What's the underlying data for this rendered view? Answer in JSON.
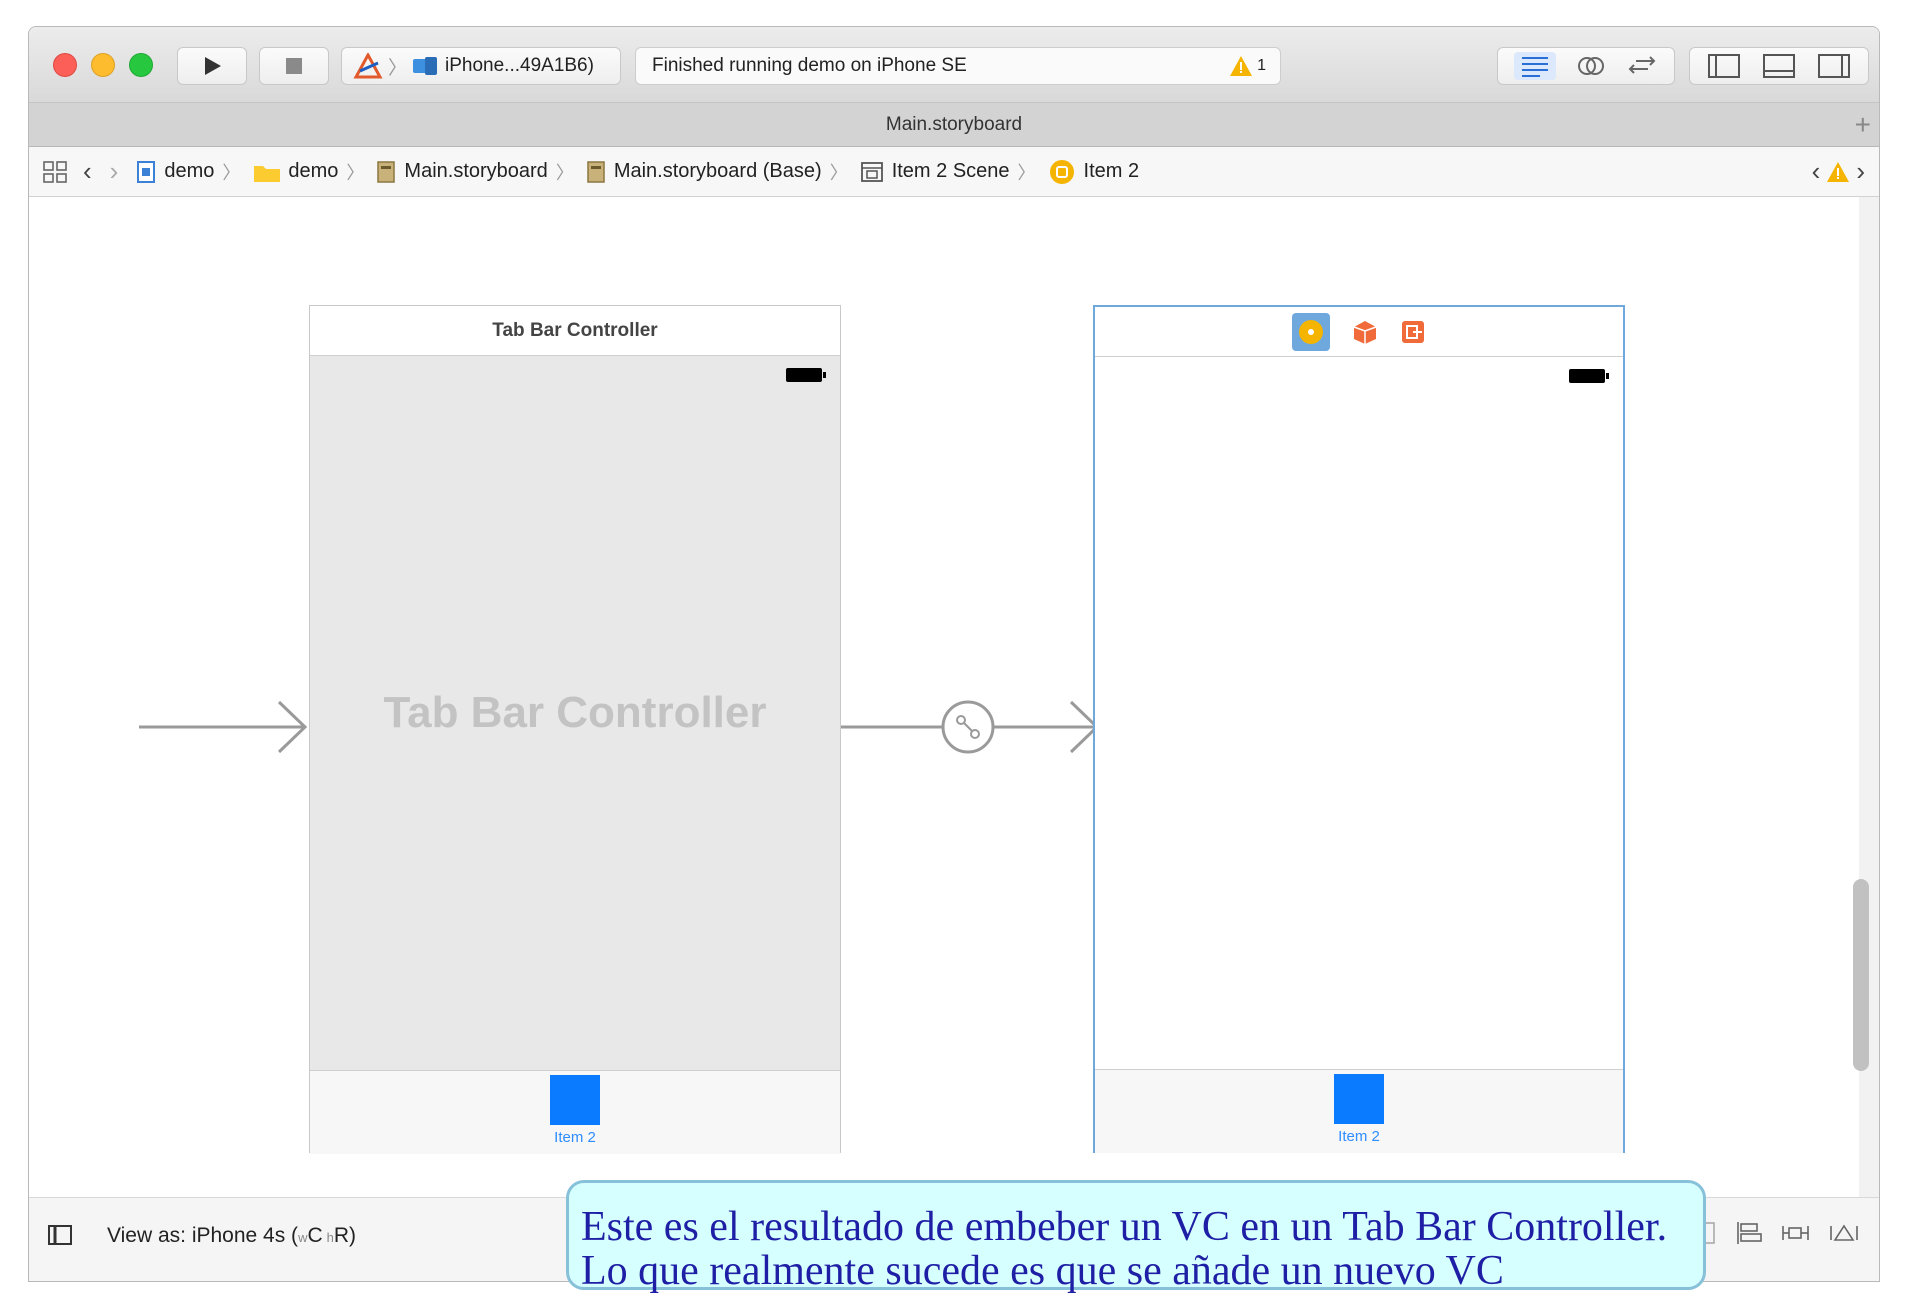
{
  "toolbar": {
    "scheme_label": "iPhone...49A1B6)",
    "status_text": "Finished running demo on iPhone SE",
    "warning_count": "1"
  },
  "tab": {
    "title": "Main.storyboard",
    "add_label": "+"
  },
  "breadcrumb": {
    "items": [
      "demo",
      "demo",
      "Main.storyboard",
      "Main.storyboard (Base)",
      "Item 2 Scene",
      "Item 2"
    ]
  },
  "scenes": {
    "tab_bar_controller": {
      "header": "Tab Bar Controller",
      "placeholder": "Tab Bar Controller",
      "tab_label": "Item 2"
    },
    "item2": {
      "tab_label": "Item 2"
    }
  },
  "bottom": {
    "view_as_prefix": "View as: iPhone 4s (",
    "w": "w",
    "w_value": "C ",
    "h": "h",
    "h_value": "R",
    "suffix": ")"
  },
  "callout": {
    "text": "Este es el resultado de embeber un VC en un Tab Bar Controller. Lo que realmente sucede es que se añade un nuevo VC"
  },
  "colors": {
    "accent": "#0a7aff",
    "selection": "#6fa8dc",
    "callout_bg": "#d6ffff",
    "callout_text": "#1f1fa6"
  }
}
